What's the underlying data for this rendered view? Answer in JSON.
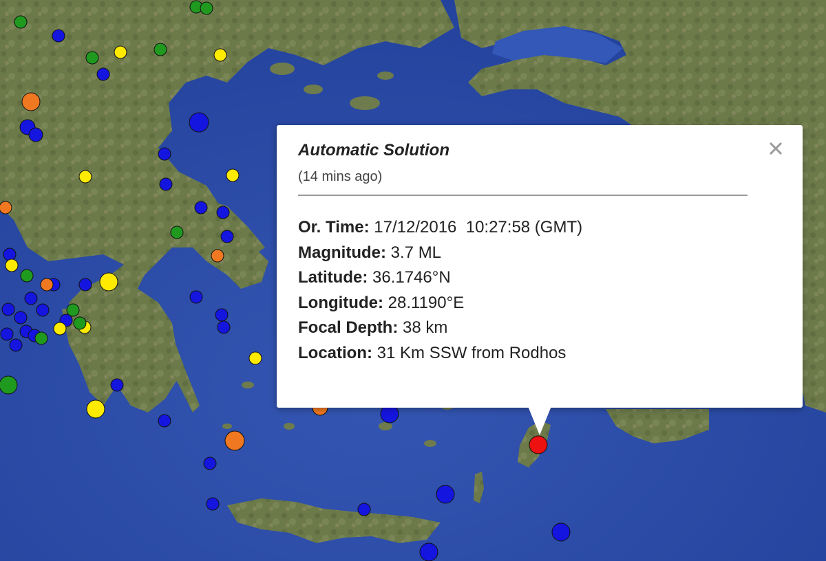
{
  "map": {
    "colors": {
      "sea_deep": "#2b4aa6",
      "sea_shallow": "#4d74c4",
      "land": "#6f7a4e",
      "land_light": "#8d8a63"
    },
    "markers": [
      {
        "color": "#1515e0",
        "icon": "earthquake-marker-blue"
      },
      {
        "color": "#ffeb00",
        "icon": "earthquake-marker-yellow"
      },
      {
        "color": "#1f9a1f",
        "icon": "earthquake-marker-green"
      },
      {
        "color": "#f07820",
        "icon": "earthquake-marker-orange"
      },
      {
        "color": "#ee1111",
        "icon": "earthquake-marker-red-selected"
      }
    ]
  },
  "info_window": {
    "title": "Automatic Solution",
    "subtitle": "(14 mins ago)",
    "close_icon": "close-icon",
    "fields": [
      {
        "label": "Or. Time:",
        "value": "17/12/2016  10:27:58 (GMT)"
      },
      {
        "label": "Magnitude:",
        "value": "3.7 ML"
      },
      {
        "label": "Latitude:",
        "value": "36.1746°N"
      },
      {
        "label": "Longitude:",
        "value": "28.1190°E"
      },
      {
        "label": "Focal Depth:",
        "value": "38 km"
      },
      {
        "label": "Location:",
        "value": "31 Km SSW from Rodhos"
      }
    ]
  }
}
